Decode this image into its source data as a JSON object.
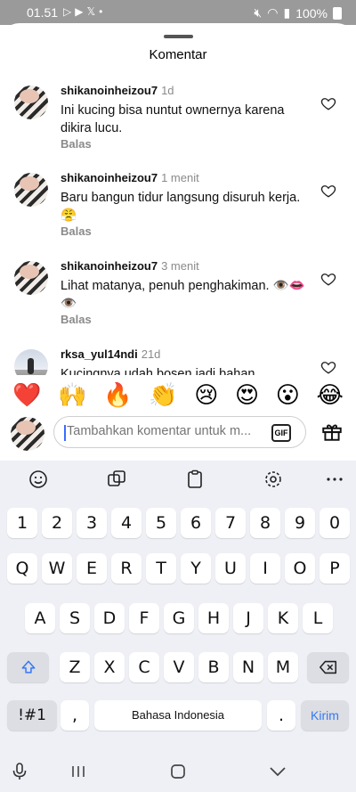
{
  "status_bar": {
    "time": "01.51",
    "battery": "100%"
  },
  "sheet": {
    "title": "Komentar"
  },
  "comments": [
    {
      "username": "shikanoinheizou7",
      "time": "1d",
      "text": "Ini kucing bisa nuntut ownernya karena dikira lucu.",
      "reply": "Balas"
    },
    {
      "username": "shikanoinheizou7",
      "time": "1 menit",
      "text": "Baru bangun tidur langsung disuruh kerja. 😤",
      "reply": "Balas"
    },
    {
      "username": "shikanoinheizou7",
      "time": "3 menit",
      "text": "Lihat matanya, penuh penghakiman. 👁️👄👁️",
      "reply": "Balas"
    },
    {
      "username": "rksa_yul14ndi",
      "time": "21d",
      "text": "Kucingnya udah bosen jadi bahan",
      "reply": ""
    }
  ],
  "emoji_bar": [
    "❤️",
    "🙌",
    "🔥",
    "👏",
    "😢",
    "😍",
    "😮",
    "😂"
  ],
  "composer": {
    "placeholder": "Tambahkan komentar untuk m...",
    "gif_label": "GIF"
  },
  "keyboard": {
    "number_row": [
      "1",
      "2",
      "3",
      "4",
      "5",
      "6",
      "7",
      "8",
      "9",
      "0"
    ],
    "row1": [
      "Q",
      "W",
      "E",
      "R",
      "T",
      "Y",
      "U",
      "I",
      "O",
      "P"
    ],
    "row2": [
      "A",
      "S",
      "D",
      "F",
      "G",
      "H",
      "J",
      "K",
      "L"
    ],
    "row3": [
      "Z",
      "X",
      "C",
      "V",
      "B",
      "N",
      "M"
    ],
    "symbols_key": "!#1",
    "comma_key": ",",
    "space_label": "Bahasa Indonesia",
    "period_key": ".",
    "send_label": "Kirim"
  },
  "colors": {
    "accent": "#3478f6",
    "keyboard_bg": "#eef0f5",
    "status_bar_bg": "#9a9a9a"
  }
}
